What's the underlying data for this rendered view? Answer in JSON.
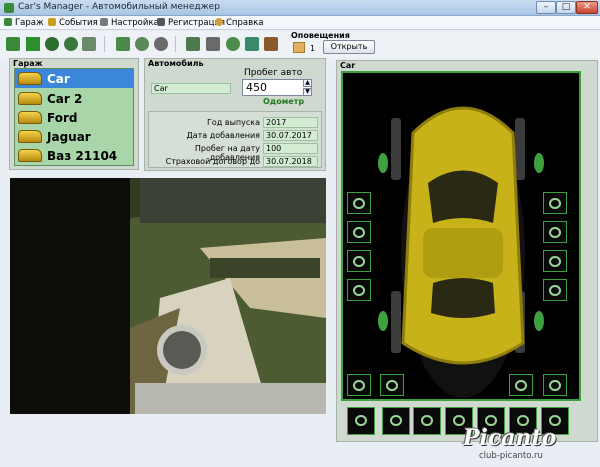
{
  "window": {
    "title": "Car's Manager - Автомобильный менеджер",
    "min": "–",
    "max": "□",
    "close": "✕"
  },
  "menu": {
    "items": [
      "Гараж",
      "События",
      "Настройка",
      "Регистрация",
      "Справка"
    ]
  },
  "toolbar": {
    "icons": [
      "car-icon",
      "sort-icon",
      "delete-icon",
      "wheel-icon",
      "walk-icon",
      "document-icon",
      "settings-icon",
      "clock-icon",
      "page-icon",
      "tools-icon",
      "gear-icon",
      "car-wash-icon",
      "toolbox-icon"
    ]
  },
  "notifications": {
    "title": "Оповещения",
    "count": "1",
    "open_label": "Открыть"
  },
  "garage": {
    "label": "Гараж",
    "items": [
      "Car",
      "Car 2",
      "Ford",
      "Jaguar",
      "Ваз 21104"
    ],
    "selected_index": 0
  },
  "auto": {
    "label": "Автомобиль",
    "name_value": "Car",
    "mileage_label": "Пробег авто",
    "mileage_value": "450",
    "odometer_label": "Одометр"
  },
  "details": {
    "rows": [
      {
        "label": "Год выпуска",
        "value": "2017"
      },
      {
        "label": "Дата добавления",
        "value": "30.07.2017"
      },
      {
        "label": "Пробег на дату добавления",
        "value": "100"
      },
      {
        "label": "Страховой договор до",
        "value": "30.07.2018"
      }
    ]
  },
  "car_panel": {
    "label": "Car"
  },
  "watermark": {
    "main": "Picanto",
    "sub": "club-picanto.ru"
  },
  "colors": {
    "accent_green": "#3fa03f",
    "list_green": "#a8d6a8",
    "selection_blue": "#3b86d9",
    "car_yellow": "#c8b21a"
  }
}
